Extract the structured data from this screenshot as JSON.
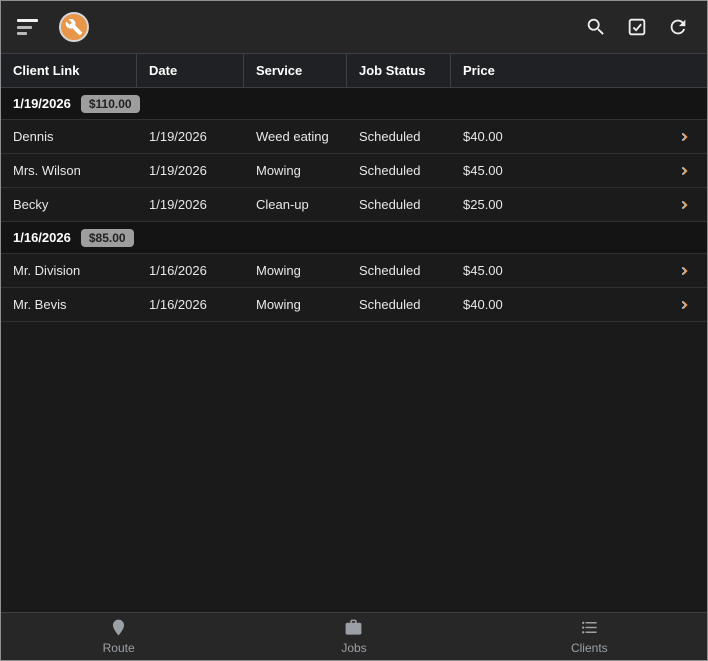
{
  "colors": {
    "accent_orange": "#E8964A",
    "badge_bg": "#9E9E9E",
    "nav_gray": "#9AA0A6"
  },
  "table": {
    "columns": [
      "Client Link",
      "Date",
      "Service",
      "Job Status",
      "Price"
    ]
  },
  "groups": [
    {
      "date": "1/19/2026",
      "total": "$110.00",
      "jobs": [
        {
          "client": "Dennis",
          "date": "1/19/2026",
          "service": "Weed eating",
          "status": "Scheduled",
          "price": "$40.00"
        },
        {
          "client": "Mrs. Wilson",
          "date": "1/19/2026",
          "service": "Mowing",
          "status": "Scheduled",
          "price": "$45.00"
        },
        {
          "client": "Becky",
          "date": "1/19/2026",
          "service": "Clean-up",
          "status": "Scheduled",
          "price": "$25.00"
        }
      ]
    },
    {
      "date": "1/16/2026",
      "total": "$85.00",
      "jobs": [
        {
          "client": "Mr. Division",
          "date": "1/16/2026",
          "service": "Mowing",
          "status": "Scheduled",
          "price": "$45.00"
        },
        {
          "client": "Mr. Bevis",
          "date": "1/16/2026",
          "service": "Mowing",
          "status": "Scheduled",
          "price": "$40.00"
        }
      ]
    }
  ],
  "bottom_nav": [
    {
      "label": "Route"
    },
    {
      "label": "Jobs"
    },
    {
      "label": "Clients"
    }
  ]
}
